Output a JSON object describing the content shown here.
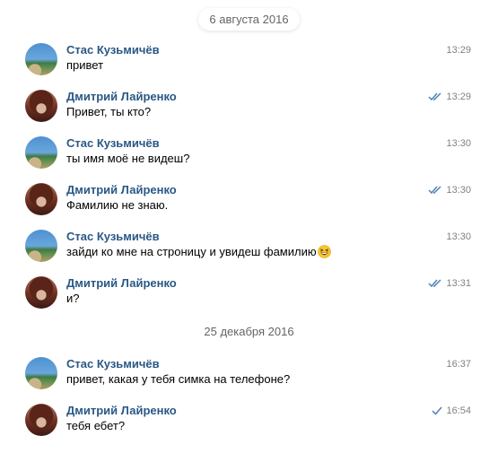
{
  "dates": [
    "6 августа 2016",
    "25 декабря 2016"
  ],
  "messages": [
    {
      "author": "Стас Кузьмичёв",
      "text": "привет",
      "time": "13:29",
      "avatar": "stas-avatar",
      "read_mark": "none"
    },
    {
      "author": "Дмитрий Лайренко",
      "text": "Привет, ты кто?",
      "time": "13:29",
      "avatar": "dmitry-avatar",
      "read_mark": "double-check-icon"
    },
    {
      "author": "Стас Кузьмичёв",
      "text": "ты имя моё не видеш?",
      "time": "13:30",
      "avatar": "stas-avatar",
      "read_mark": "none"
    },
    {
      "author": "Дмитрий Лайренко",
      "text": "Фамилию не знаю.",
      "time": "13:30",
      "avatar": "dmitry-avatar",
      "read_mark": "double-check-icon"
    },
    {
      "author": "Стас Кузьмичёв",
      "text": "зайди ко мне на строницу и увидеш фамилию",
      "time": "13:30",
      "avatar": "stas-avatar",
      "read_mark": "none",
      "emoji": "laughing-face-emoji"
    },
    {
      "author": "Дмитрий Лайренко",
      "text": "и?",
      "time": "13:31",
      "avatar": "dmitry-avatar",
      "read_mark": "double-check-icon"
    },
    {
      "author": "Стас Кузьмичёв",
      "text": "привет, какая у тебя симка на телефоне?",
      "time": "16:37",
      "avatar": "stas-avatar",
      "read_mark": "none"
    },
    {
      "author": "Дмитрий Лайренко",
      "text": "тебя ебет?",
      "time": "16:54",
      "avatar": "dmitry-avatar",
      "read_mark": "check-icon"
    }
  ],
  "colors": {
    "author_name": "#2a5885",
    "timestamp": "#828282",
    "date_separator": "#656565",
    "read_check": "#5181b8",
    "background": "#ffffff"
  }
}
